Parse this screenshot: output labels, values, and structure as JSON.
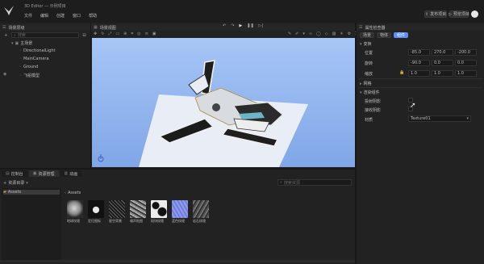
{
  "colors": {
    "accent": "#5d8df5",
    "viewport_sky": "#9ec0f5",
    "panel": "#222222",
    "background": "#181818"
  },
  "titlebar": {
    "title": "3D  Editor — 示例项目",
    "icon": "bird-logo-icon"
  },
  "menu": [
    "文件",
    "编辑",
    "创建",
    "窗口",
    "帮助"
  ],
  "top_right": {
    "publish_label": "发布项目",
    "preview_label": "预览项目"
  },
  "hierarchy": {
    "title": "场景层级",
    "search_placeholder": "搜索",
    "items": [
      {
        "label": "主场景",
        "icon": "folder-icon"
      },
      {
        "label": "DirectionalLight",
        "icon": "light-icon"
      },
      {
        "label": "MainCamera",
        "icon": "camera-icon"
      },
      {
        "label": "Ground",
        "icon": "cube-icon"
      },
      {
        "label": "飞船模型",
        "icon": "cube-icon"
      }
    ]
  },
  "viewport": {
    "title": "场景视图"
  },
  "inspector": {
    "title": "属性检查器",
    "tabs": [
      "场景",
      "物体",
      "组件"
    ],
    "section_transform": "变换",
    "position": {
      "label": "位置",
      "x": "-85.0",
      "y": "270.0",
      "z": "-200.0"
    },
    "rotation": {
      "label": "旋转",
      "x": "-90.0",
      "y": "0.0",
      "z": "0.0"
    },
    "scale": {
      "label": "缩放",
      "x": "1.0",
      "y": "1.0",
      "z": "1.0"
    },
    "section_mesh": "网格",
    "section_render": "渲染组件",
    "cast_shadow_label": "投射阴影",
    "receive_shadow_label": "接收阴影",
    "material_label": "材质",
    "material_value": "Texture01"
  },
  "bottom": {
    "tabs": [
      "控制台",
      "资源管理",
      "动画"
    ],
    "assets_header": "资源目录",
    "search_placeholder": "搜索资源",
    "folder": "Assets",
    "breadcrumb": "Assets",
    "assets": [
      {
        "name": "地球纹理",
        "style": "globe"
      },
      {
        "name": "定位图标",
        "style": "pin"
      },
      {
        "name": "星空背景",
        "style": "stars"
      },
      {
        "name": "噪声贴图",
        "style": "noise"
      },
      {
        "name": "斑块纹理",
        "style": "blotch"
      },
      {
        "name": "蓝色纹理",
        "style": "blue"
      },
      {
        "name": "岩石纹理",
        "style": "rock"
      }
    ]
  }
}
